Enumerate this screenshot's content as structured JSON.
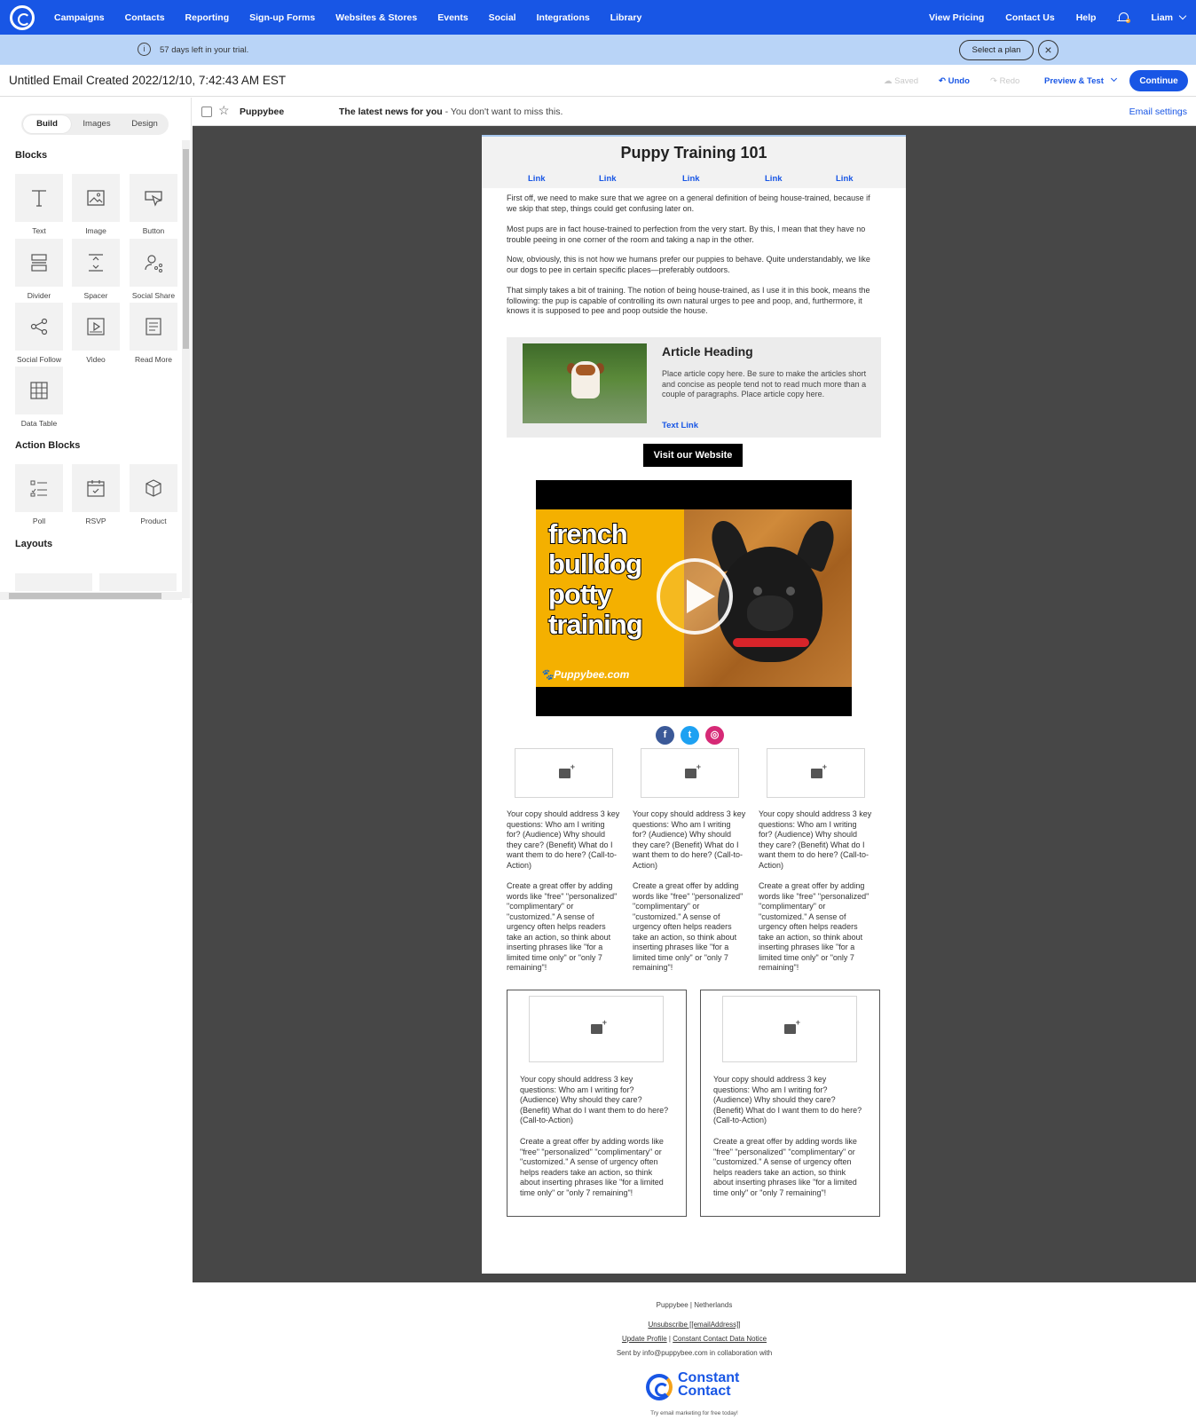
{
  "topnav": {
    "items": [
      "Campaigns",
      "Contacts",
      "Reporting",
      "Sign-up Forms",
      "Websites & Stores",
      "Events",
      "Social",
      "Integrations",
      "Library"
    ],
    "right_items": [
      "View Pricing",
      "Contact Us",
      "Help"
    ],
    "user": "Liam"
  },
  "trial": {
    "message": "57 days left in your trial.",
    "select_plan": "Select a plan"
  },
  "titlebar": {
    "title": "Untitled Email Created 2022/12/10, 7:42:43 AM EST",
    "saved": "Saved",
    "undo": "Undo",
    "redo": "Redo",
    "preview": "Preview & Test",
    "continue": "Continue"
  },
  "sidebar": {
    "tabs": [
      "Build",
      "Images",
      "Design"
    ],
    "active_tab": "Build",
    "blocks_title": "Blocks",
    "blocks": [
      "Text",
      "Image",
      "Button",
      "Divider",
      "Spacer",
      "Social Share",
      "Social Follow",
      "Video",
      "Read More",
      "Data Table"
    ],
    "action_blocks_title": "Action Blocks",
    "action_blocks": [
      "Poll",
      "RSVP",
      "Product"
    ],
    "layouts_title": "Layouts"
  },
  "subjectbar": {
    "sender": "Puppybee",
    "subject": "The latest news for you",
    "preheader": " - You don't want to miss this.",
    "email_settings": "Email settings"
  },
  "email": {
    "title": "Puppy Training 101",
    "links": [
      "Link",
      "Link",
      "Link",
      "Link",
      "Link"
    ],
    "paragraphs": [
      "First off, we need to make sure that we agree on a general definition of being house-trained, because if we skip that step, things could get confusing later on.",
      "Most pups are in fact house-trained to perfection from the very start. By this, I mean that they have no trouble peeing in one corner of the room and taking a nap in the other.",
      "Now, obviously, this is not how we humans prefer our puppies to behave. Quite understandably, we like our dogs to pee in certain specific places—preferably outdoors.",
      "That simply takes a bit of training. The notion of being house-trained, as I use it in this book, means the following: the pup is capable of controlling its own natural urges to pee and poop, and, furthermore, it knows it is supposed to pee and poop outside the house."
    ],
    "article": {
      "heading": "Article Heading",
      "copy": "Place article copy here. Be sure to make the articles short and concise as people tend not to read much more than a couple of paragraphs. Place article copy here.",
      "link": "Text Link"
    },
    "button": "Visit our Website",
    "video": {
      "lines": [
        "french",
        "bulldog",
        "potty",
        "training"
      ],
      "brand": "Puppybee.com"
    },
    "copy_a": "Your copy should address 3 key questions: Who am I writing for? (Audience) Why should they care? (Benefit) What do I want them to do here? (Call-to-Action)",
    "copy_b": "Create a great offer by adding words like \"free\" \"personalized\" \"complimentary\" or \"customized.\" A sense of urgency often helps readers take an action, so think about inserting phrases like \"for a limited time only\" or \"only 7 remaining\"!"
  },
  "footer": {
    "org": "Puppybee | Netherlands",
    "unsubscribe": "Unsubscribe [[emailAddress]]",
    "update_profile": "Update Profile",
    "separator": " | ",
    "data_notice": "Constant Contact Data Notice",
    "sent_by": "Sent by info@puppybee.com in collaboration with",
    "logo_line1": "Constant",
    "logo_line2": "Contact",
    "tagline": "Try email marketing for free today!"
  },
  "colors": {
    "brand_blue": "#1856e5",
    "trial_bar": "#b9d4f7",
    "canvas": "#474747"
  }
}
